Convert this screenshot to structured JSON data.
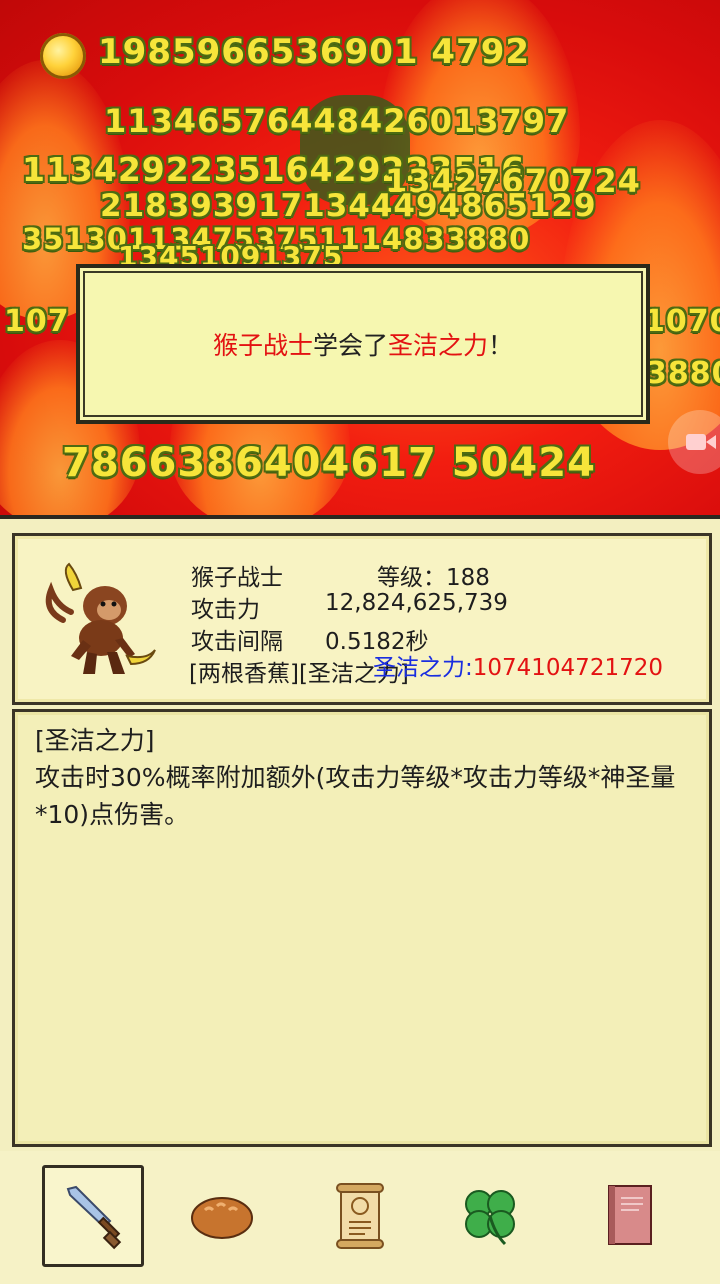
{
  "gold": {
    "icon": "gold-coin-icon",
    "amount": "1985966536901 4792"
  },
  "damage_numbers": [
    "11346576448426013797",
    "113429223516429223516",
    "13427670724",
    "2183939171344494865129",
    "351301134753751114833880",
    "13451091375",
    "107",
    "1070",
    "3880",
    "7866386404617 50424"
  ],
  "popup": {
    "unit_name": "猴子战士",
    "middle": "学会了",
    "skill_name": "圣洁之力",
    "suffix": "！"
  },
  "unit": {
    "name": "猴子战士",
    "level_label": "等级：",
    "level": "188",
    "attack_label": "攻击力",
    "attack": "12,824,625,739",
    "interval_label": "攻击间隔",
    "interval": "0.5182秒",
    "equipment": "[两根香蕉][圣洁之力]",
    "skill_label": "圣洁之力:",
    "skill_damage": "1074104721720",
    "portrait_icon": "monkey-warrior-icon"
  },
  "description": {
    "title": "[圣洁之力]",
    "body": "攻击时30%概率附加额外(攻击力等级*攻击力等级*神圣量*10)点伤害。"
  },
  "tabs": [
    {
      "icon": "sword-icon",
      "active": true
    },
    {
      "icon": "bread-icon",
      "active": false
    },
    {
      "icon": "scroll-icon",
      "active": false
    },
    {
      "icon": "clover-icon",
      "active": false
    },
    {
      "icon": "book-icon",
      "active": false
    }
  ],
  "colors": {
    "accent_red": "#e31212",
    "skill_blue": "#1a2ee0",
    "panel_bg": "#f3efc0",
    "damage_yellow": "#f7e53a"
  }
}
